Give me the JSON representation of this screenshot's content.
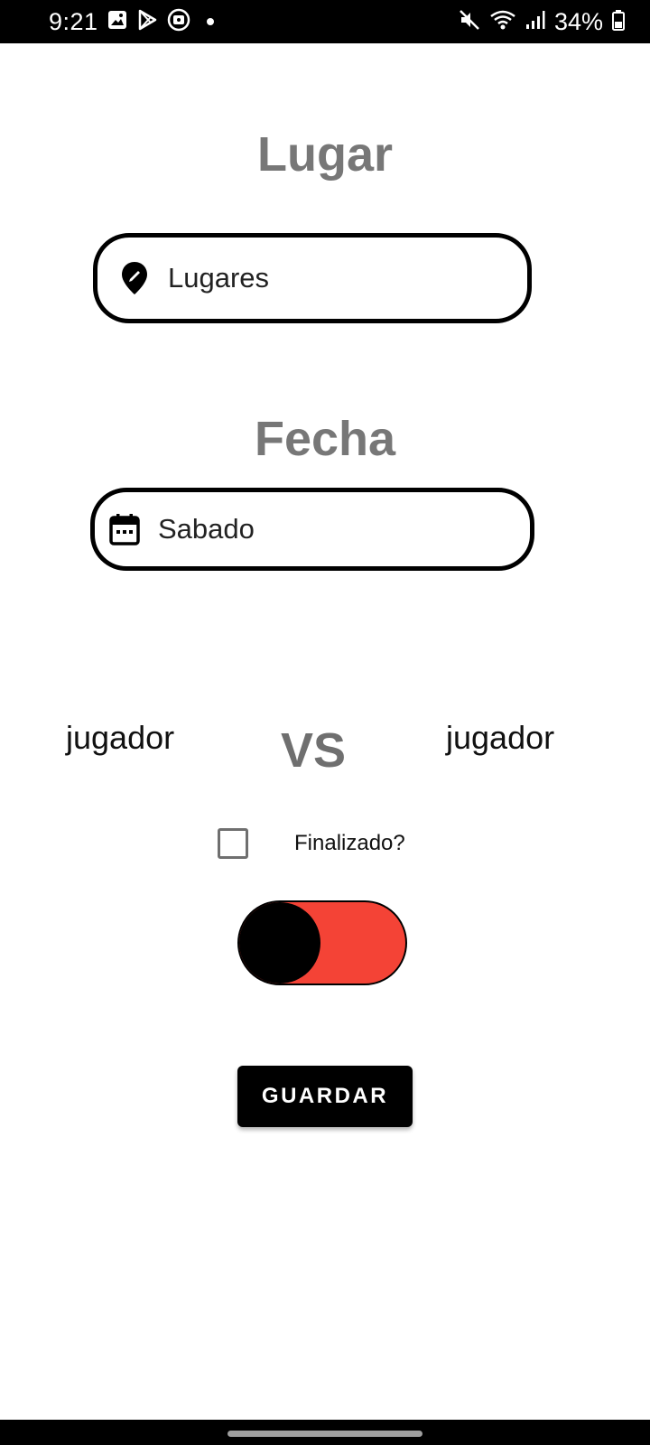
{
  "status_bar": {
    "time": "9:21",
    "battery_percent": "34%",
    "left_icons": [
      "gallery-icon",
      "play-store-icon",
      "app-notification-icon",
      "notification-dot"
    ],
    "right_icons": [
      "mute-icon",
      "wifi-icon",
      "signal-icon",
      "battery-icon"
    ]
  },
  "place": {
    "heading": "Lugar",
    "value": "Lugares",
    "icon": "location-pin-icon"
  },
  "date": {
    "heading": "Fecha",
    "value": "Sabado",
    "icon": "calendar-icon"
  },
  "match": {
    "player1": "jugador",
    "vs": "VS",
    "player2": "jugador"
  },
  "finished": {
    "label": "Finalizado?",
    "checked": false
  },
  "toggle": {
    "on": false,
    "track_color": "#f44336",
    "thumb_color": "#000000"
  },
  "actions": {
    "save_label": "GUARDAR"
  }
}
